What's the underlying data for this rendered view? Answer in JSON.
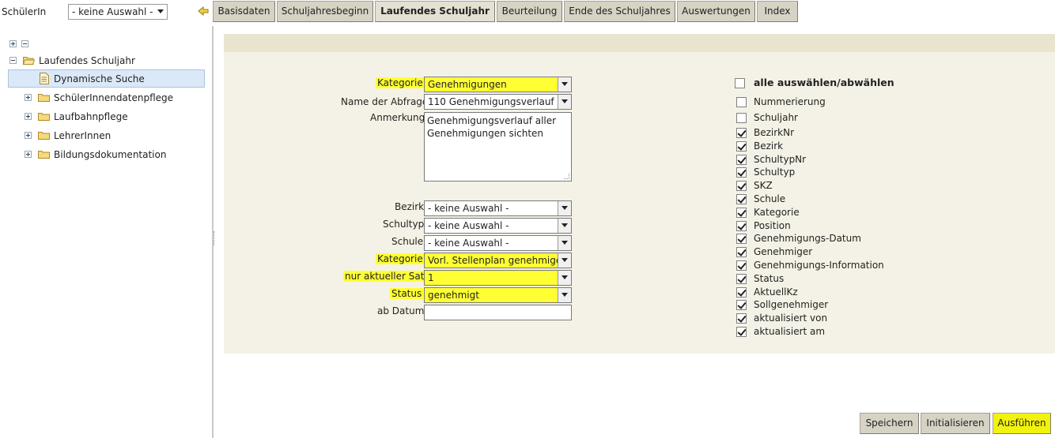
{
  "top": {
    "student_label": "SchülerIn",
    "student_select_value": "- keine Auswahl -",
    "tabs": [
      "Basisdaten",
      "Schuljahresbeginn",
      "Laufendes Schuljahr",
      "Beurteilung",
      "Ende des Schuljahres",
      "Auswertungen",
      "Index"
    ],
    "active_tab": "Laufendes Schuljahr"
  },
  "tree": {
    "root_label": "Laufendes Schuljahr",
    "items": [
      "Dynamische Suche",
      "SchülerInnendatenpflege",
      "Laufbahnpflege",
      "LehrerInnen",
      "Bildungsdokumentation"
    ],
    "selected": "Dynamische Suche"
  },
  "form": {
    "kategorie_label": "Kategorie",
    "kategorie_value": "Genehmigungen",
    "abfrage_label": "Name der Abfrage",
    "abfrage_value": "110 Genehmigungsverlauf",
    "anmerkung_label": "Anmerkung",
    "anmerkung_value": "Genehmigungsverlauf aller Genehmigungen sichten",
    "filters": [
      {
        "label": "Bezirk",
        "value": "- keine Auswahl -",
        "highlight": false
      },
      {
        "label": "Schultyp",
        "value": "- keine Auswahl -",
        "highlight": false
      },
      {
        "label": "Schule",
        "value": "- keine Auswahl -",
        "highlight": false
      },
      {
        "label": "Kategorie",
        "value": "Vorl. Stellenplan genehmigen",
        "highlight": true
      },
      {
        "label": "nur aktueller Satz",
        "value": "1",
        "highlight": true
      },
      {
        "label": "Status",
        "value": "genehmigt",
        "highlight": true
      }
    ],
    "ab_datum_label": "ab Datum",
    "ab_datum_value": ""
  },
  "columns": {
    "select_all_label": "alle auswählen/abwählen",
    "select_all_checked": false,
    "items": [
      {
        "label": "Nummerierung",
        "checked": false
      },
      {
        "label": "Schuljahr",
        "checked": false
      },
      {
        "label": "BezirkNr",
        "checked": true
      },
      {
        "label": "Bezirk",
        "checked": true
      },
      {
        "label": "SchultypNr",
        "checked": true
      },
      {
        "label": "Schultyp",
        "checked": true
      },
      {
        "label": "SKZ",
        "checked": true
      },
      {
        "label": "Schule",
        "checked": true
      },
      {
        "label": "Kategorie",
        "checked": true
      },
      {
        "label": "Position",
        "checked": true
      },
      {
        "label": "Genehmigungs-Datum",
        "checked": true
      },
      {
        "label": "Genehmiger",
        "checked": true
      },
      {
        "label": "Genehmigungs-Information",
        "checked": true
      },
      {
        "label": "Status",
        "checked": true
      },
      {
        "label": "AktuellKz",
        "checked": true
      },
      {
        "label": "Sollgenehmiger",
        "checked": true
      },
      {
        "label": "aktualisiert von",
        "checked": true
      },
      {
        "label": "aktualisiert am",
        "checked": true
      }
    ]
  },
  "buttons": {
    "save": "Speichern",
    "init": "Initialisieren",
    "run": "Ausführen"
  },
  "colors": {
    "highlight": "#ffff33",
    "panel_bg": "#f4f2e6",
    "panel_header": "#e9e4cd",
    "button_bg": "#d6d2c4"
  }
}
